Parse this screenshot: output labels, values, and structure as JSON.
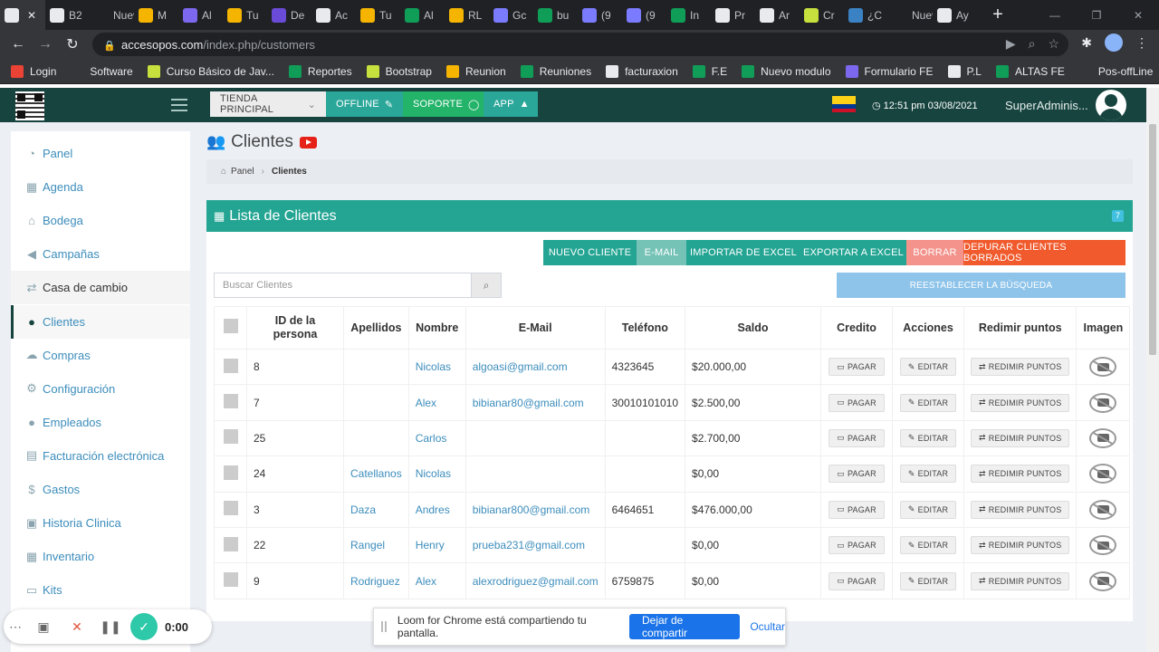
{
  "browser": {
    "tabs": [
      {
        "label": "",
        "color": "#e8eaed",
        "active": true
      },
      {
        "label": "B2",
        "color": "#e8eaed"
      },
      {
        "label": "Nueva",
        "color": "#202124"
      },
      {
        "label": "M",
        "color": "#f4b400"
      },
      {
        "label": "Al",
        "color": "#7b68ee"
      },
      {
        "label": "Tu",
        "color": "#f4b400"
      },
      {
        "label": "De",
        "color": "#6a4bd8"
      },
      {
        "label": "Ac",
        "color": "#e8eaed"
      },
      {
        "label": "Tu",
        "color": "#f4b400"
      },
      {
        "label": "Al",
        "color": "#0f9d58"
      },
      {
        "label": "RL",
        "color": "#f4b400"
      },
      {
        "label": "Gc",
        "color": "#7b7bff"
      },
      {
        "label": "bu",
        "color": "#0f9d58"
      },
      {
        "label": "(9",
        "color": "#7b7bff"
      },
      {
        "label": "(9",
        "color": "#7b7bff"
      },
      {
        "label": "In",
        "color": "#0f9d58"
      },
      {
        "label": "Pr",
        "color": "#e8eaed"
      },
      {
        "label": "Ar",
        "color": "#e8eaed"
      },
      {
        "label": "Cr",
        "color": "#c6e03d"
      },
      {
        "label": "¿C",
        "color": "#3b82c4"
      },
      {
        "label": "Nueva",
        "color": "#202124"
      },
      {
        "label": "Ay",
        "color": "#e8eaed"
      }
    ],
    "url_host": "accesopos.com",
    "url_path": "/index.php/customers",
    "bookmarks": [
      {
        "label": "Login",
        "color": "#ea4335"
      },
      {
        "label": "Software",
        "color": "#35363a"
      },
      {
        "label": "Curso Básico de Jav...",
        "color": "#c6e03d"
      },
      {
        "label": "Reportes",
        "color": "#0f9d58"
      },
      {
        "label": "Bootstrap",
        "color": "#c6e03d"
      },
      {
        "label": "Reunion",
        "color": "#f4b400"
      },
      {
        "label": "Reuniones",
        "color": "#0f9d58"
      },
      {
        "label": "facturaxion",
        "color": "#e8eaed"
      },
      {
        "label": "F.E",
        "color": "#0f9d58"
      },
      {
        "label": "Nuevo modulo",
        "color": "#0f9d58"
      },
      {
        "label": "Formulario FE",
        "color": "#7b68ee"
      },
      {
        "label": "P.L",
        "color": "#e8eaed"
      },
      {
        "label": "ALTAS FE",
        "color": "#0f9d58"
      },
      {
        "label": "Pos-offLine",
        "color": "#35363a"
      }
    ]
  },
  "header": {
    "store": "TIENDA PRINCIPAL",
    "offline": "OFFLINE",
    "soporte": "SOPORTE",
    "app": "APP",
    "clock": "12:51 pm 03/08/2021",
    "user": "SuperAdminis..."
  },
  "sidebar": {
    "items": [
      {
        "label": "Panel",
        "icon": "dashboard-icon",
        "glyph": "◔"
      },
      {
        "label": "Agenda",
        "icon": "calendar-icon",
        "glyph": "▦"
      },
      {
        "label": "Bodega",
        "icon": "bank-icon",
        "glyph": "⌂"
      },
      {
        "label": "Campañas",
        "icon": "bullhorn-icon",
        "glyph": "◀"
      },
      {
        "label": "Casa de cambio",
        "icon": "exchange-icon",
        "glyph": "⇄"
      },
      {
        "label": "Clientes",
        "icon": "users-icon",
        "glyph": "●"
      },
      {
        "label": "Compras",
        "icon": "cloud-download-icon",
        "glyph": "☁"
      },
      {
        "label": "Configuración",
        "icon": "cogs-icon",
        "glyph": "⚙"
      },
      {
        "label": "Empleados",
        "icon": "user-icon",
        "glyph": "●"
      },
      {
        "label": "Facturación electrónica",
        "icon": "file-icon",
        "glyph": "▤"
      },
      {
        "label": "Gastos",
        "icon": "dollar-icon",
        "glyph": "$"
      },
      {
        "label": "Historia Clinica",
        "icon": "medkit-icon",
        "glyph": "▣"
      },
      {
        "label": "Inventario",
        "icon": "table-icon",
        "glyph": "▦"
      },
      {
        "label": "Kits",
        "icon": "inbox-icon",
        "glyph": "▭"
      }
    ]
  },
  "page": {
    "title": "Clientes",
    "crumb_home": "Panel",
    "crumb_current": "Clientes",
    "box_title": "Lista de Clientes",
    "badge": "7",
    "search_placeholder": "Buscar Clientes",
    "reset_label": "REESTABLECER LA BÚSQUEDA",
    "actions": [
      {
        "label": "NUEVO CLIENTE",
        "color": "#24a593"
      },
      {
        "label": "E-MAIL",
        "color": "#75c2b6"
      },
      {
        "label": "IMPORTAR DE EXCEL",
        "color": "#24a593"
      },
      {
        "label": "EXPORTAR A EXCEL",
        "color": "#24a593"
      },
      {
        "label": "BORRAR",
        "color": "#f3938c"
      },
      {
        "label": "DEPURAR CLIENTES BORRADOS",
        "color": "#f05a2c"
      }
    ]
  },
  "table": {
    "columns": [
      "ID de la persona",
      "Apellidos",
      "Nombre",
      "E-Mail",
      "Teléfono",
      "Saldo",
      "Credito",
      "Acciones",
      "Redimir puntos",
      "Imagen"
    ],
    "pay_label": "PAGAR",
    "edit_label": "EDITAR",
    "redeem_label": "REDIMIR PUNTOS",
    "rows": [
      {
        "id": "8",
        "apellidos": "",
        "nombre": "Nicolas",
        "email": "algoasi@gmail.com",
        "telefono": "4323645",
        "saldo": "$20.000,00"
      },
      {
        "id": "7",
        "apellidos": "",
        "nombre": "Alex",
        "email": "bibianar80@gmail.com",
        "telefono": "30010101010",
        "saldo": "$2.500,00"
      },
      {
        "id": "25",
        "apellidos": "",
        "nombre": "Carlos",
        "email": "",
        "telefono": "",
        "saldo": "$2.700,00"
      },
      {
        "id": "24",
        "apellidos": "Catellanos",
        "nombre": "Nicolas",
        "email": "",
        "telefono": "",
        "saldo": "$0,00"
      },
      {
        "id": "3",
        "apellidos": "Daza",
        "nombre": "Andres",
        "email": "bibianar800@gmail.com",
        "telefono": "6464651",
        "saldo": "$476.000,00"
      },
      {
        "id": "22",
        "apellidos": "Rangel",
        "nombre": "Henry",
        "email": "prueba231@gmail.com",
        "telefono": "",
        "saldo": "$0,00"
      },
      {
        "id": "9",
        "apellidos": "Rodriguez",
        "nombre": "Alex",
        "email": "alexrodriguez@gmail.com",
        "telefono": "6759875",
        "saldo": "$0,00"
      }
    ]
  },
  "loom": {
    "timer": "0:00",
    "share_text": "Loom for Chrome está compartiendo tu pantalla.",
    "stop_label": "Dejar de compartir",
    "hide_label": "Ocultar"
  }
}
